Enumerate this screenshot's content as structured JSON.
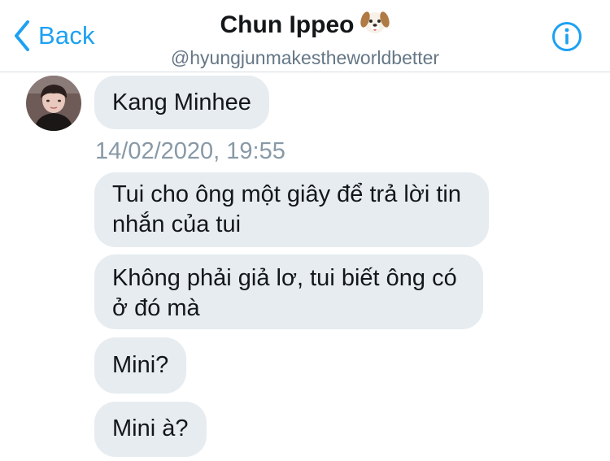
{
  "header": {
    "back_label": "Back",
    "title": "Chun Ippeo",
    "handle": "@hyungjunmakestheworldbetter",
    "title_emoji": "dog-face-icon"
  },
  "colors": {
    "accent": "#1da1f2",
    "bubble": "#e6ecf0",
    "timestamp": "#8899a6"
  },
  "messages": [
    {
      "text": "Kang Minhee"
    },
    {
      "text": "Tui cho ông một giây để trả lời tin nhắn của tui"
    },
    {
      "text": "Không phải giả lơ, tui biết ông có ở đó mà"
    },
    {
      "text": "Mini?"
    },
    {
      "text": "Mini à?"
    }
  ],
  "timestamp": "14/02/2020, 19:55"
}
